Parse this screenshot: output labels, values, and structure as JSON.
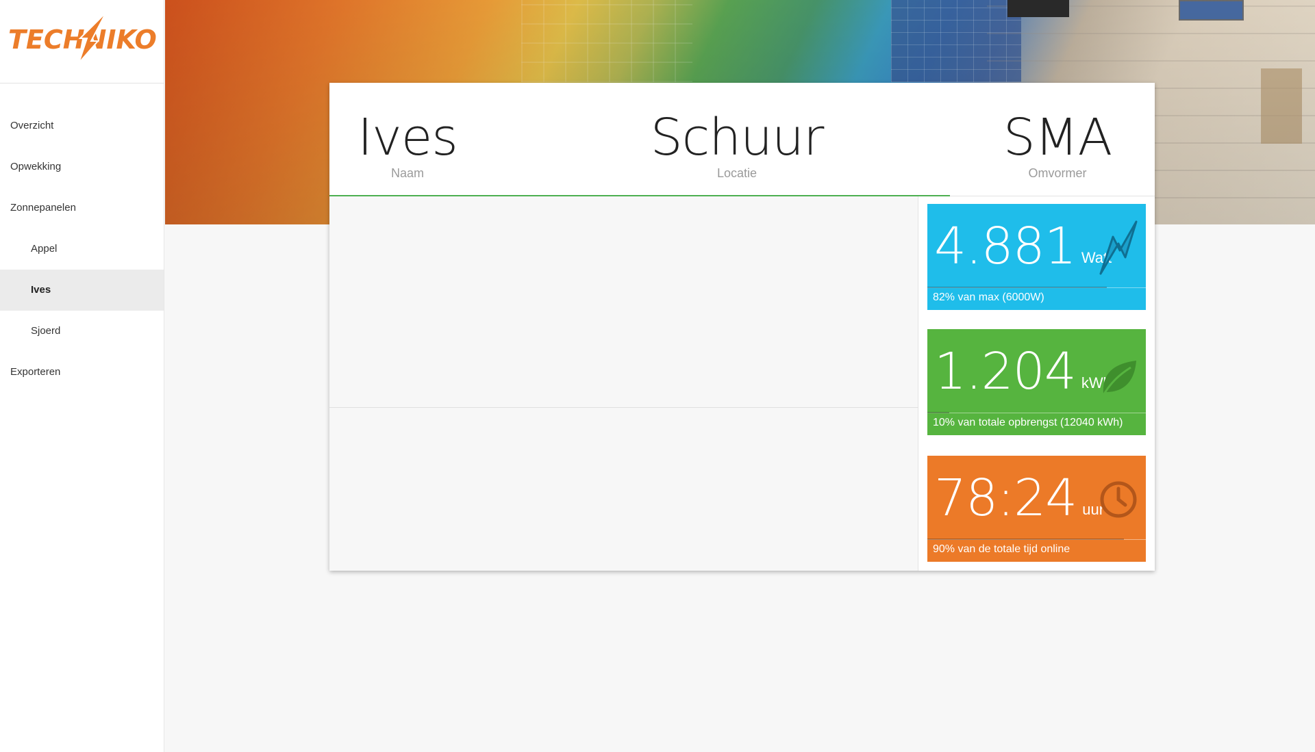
{
  "brand": {
    "name": "TECHNIKO",
    "color": "#ec7d2a"
  },
  "nav": {
    "items": [
      {
        "label": "Overzicht",
        "level": 1,
        "active": false
      },
      {
        "label": "Opwekking",
        "level": 1,
        "active": false
      },
      {
        "label": "Zonnepanelen",
        "level": 1,
        "active": false
      },
      {
        "label": "Appel",
        "level": 2,
        "active": false
      },
      {
        "label": "Ives",
        "level": 2,
        "active": true
      },
      {
        "label": "Sjoerd",
        "level": 2,
        "active": false
      },
      {
        "label": "Exporteren",
        "level": 1,
        "active": false
      }
    ]
  },
  "header": {
    "name": {
      "value": "Ives",
      "label": "Naam"
    },
    "location": {
      "value": "Schuur",
      "label": "Locatie"
    },
    "inverter": {
      "value": "SMA",
      "label": "Omvormer"
    },
    "progress_color": "#4caf50"
  },
  "tiles": {
    "power": {
      "value": "4.881",
      "unit": "Watt",
      "caption": "82% van max (6000W)",
      "fraction": 0.82,
      "icon": "lightning-bolt-icon",
      "color": "#1fbdea"
    },
    "energy": {
      "value": "1.204",
      "unit": "kWh",
      "caption": "10% van totale opbrengst (12040 kWh)",
      "fraction": 0.1,
      "icon": "leaf-icon",
      "color": "#56b43f"
    },
    "uptime": {
      "value": "78:24",
      "unit": "uur",
      "caption": "90% van de totale tijd online",
      "fraction": 0.9,
      "icon": "clock-icon",
      "color": "#ec7a28"
    }
  }
}
